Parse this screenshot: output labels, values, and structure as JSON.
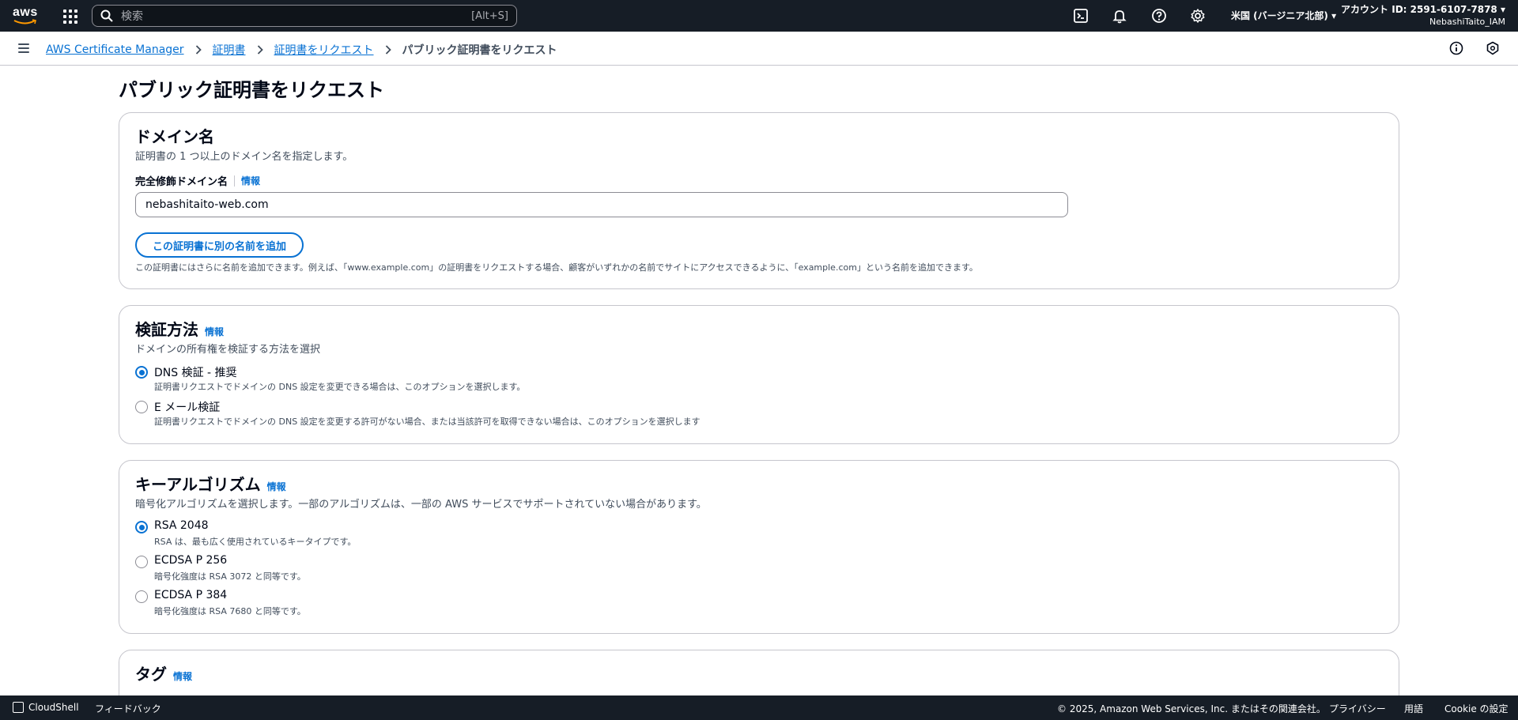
{
  "topnav": {
    "logo_text": "aws",
    "search_placeholder": "検索",
    "search_shortcut": "[Alt+S]",
    "region": "米国 (バージニア北部) ▾",
    "account_id": "アカウント ID: 2591-6107-7878 ▾",
    "account_user": "NebashiTaito_IAM"
  },
  "breadcrumb": {
    "items": [
      "AWS Certificate Manager",
      "証明書",
      "証明書をリクエスト"
    ],
    "current": "パブリック証明書をリクエスト"
  },
  "page": {
    "title": "パブリック証明書をリクエスト"
  },
  "domain_card": {
    "title": "ドメイン名",
    "description": "証明書の 1 つ以上のドメイン名を指定します。",
    "field_label": "完全修飾ドメイン名",
    "info": "情報",
    "field_value": "nebashitaito-web.com",
    "add_button": "この証明書に別の名前を追加",
    "help": "この証明書にはさらに名前を追加できます。例えば、「www.example.com」の証明書をリクエストする場合、顧客がいずれかの名前でサイトにアクセスできるように、「example.com」という名前を追加できます。"
  },
  "validation_card": {
    "title": "検証方法",
    "info": "情報",
    "description": "ドメインの所有権を検証する方法を選択",
    "options": [
      {
        "label": "DNS 検証 - 推奨",
        "desc": "証明書リクエストでドメインの DNS 設定を変更できる場合は、このオプションを選択します。",
        "selected": true
      },
      {
        "label": "E メール検証",
        "desc": "証明書リクエストでドメインの DNS 設定を変更する許可がない場合、または当該許可を取得できない場合は、このオプションを選択します",
        "selected": false
      }
    ]
  },
  "key_card": {
    "title": "キーアルゴリズム",
    "info": "情報",
    "description": "暗号化アルゴリズムを選択します。一部のアルゴリズムは、一部の AWS サービスでサポートされていない場合があります。",
    "options": [
      {
        "label": "RSA 2048",
        "desc": "RSA は、最も広く使用されているキータイプです。",
        "selected": true
      },
      {
        "label": "ECDSA P 256",
        "desc": "暗号化強度は RSA 3072 と同等です。",
        "selected": false
      },
      {
        "label": "ECDSA P 384",
        "desc": "暗号化強度は RSA 7680 と同等です。",
        "selected": false
      }
    ]
  },
  "tag_card": {
    "title": "タグ",
    "info": "情報"
  },
  "footer": {
    "cloudshell": "CloudShell",
    "feedback": "フィードバック",
    "copyright": "© 2025, Amazon Web Services, Inc. またはその関連会社。",
    "privacy": "プライバシー",
    "terms": "用語",
    "cookie": "Cookie の設定"
  }
}
